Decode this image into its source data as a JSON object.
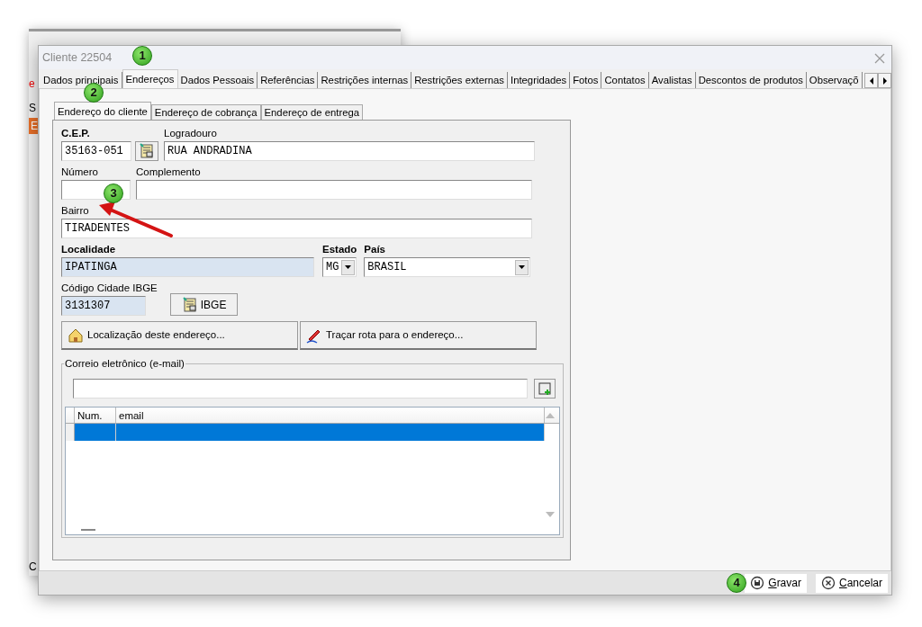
{
  "background_window": {
    "texts": [
      "e",
      "S",
      "E",
      "C"
    ]
  },
  "window": {
    "title": "Cliente 22504"
  },
  "tabs": [
    {
      "label": "Dados principais",
      "selected": false
    },
    {
      "label": "Endereços",
      "selected": true
    },
    {
      "label": "Dados Pessoais",
      "selected": false
    },
    {
      "label": "Referências",
      "selected": false
    },
    {
      "label": "Restrições internas",
      "selected": false
    },
    {
      "label": "Restrições externas",
      "selected": false
    },
    {
      "label": "Integridades",
      "selected": false
    },
    {
      "label": "Fotos",
      "selected": false
    },
    {
      "label": "Contatos",
      "selected": false
    },
    {
      "label": "Avalistas",
      "selected": false
    },
    {
      "label": "Descontos de produtos",
      "selected": false
    },
    {
      "label": "Observaçõ",
      "selected": false
    }
  ],
  "subtabs": [
    {
      "label": "Endereço do cliente",
      "selected": true
    },
    {
      "label": "Endereço de cobrança",
      "selected": false
    },
    {
      "label": "Endereço de entrega",
      "selected": false
    }
  ],
  "fields": {
    "cep": {
      "label": "C.E.P.",
      "value": "35163-051",
      "bold": true
    },
    "logradouro": {
      "label": "Logradouro",
      "value": "RUA ANDRADINA",
      "bold": false
    },
    "numero": {
      "label": "Número",
      "bold": false
    },
    "complemento": {
      "label": "Complemento",
      "bold": false
    },
    "bairro": {
      "label": "Bairro",
      "value": "TIRADENTES",
      "bold": false
    },
    "localidade": {
      "label": "Localidade",
      "value": "IPATINGA",
      "bold": true,
      "readonly": true
    },
    "estado": {
      "label": "Estado",
      "value": "MG",
      "bold": true
    },
    "pais": {
      "label": "País",
      "value": "BRASIL",
      "bold": true
    },
    "ibge": {
      "label": "Código Cidade IBGE",
      "value": "3131307",
      "bold": false,
      "readonly": true
    }
  },
  "ibge_button": "IBGE",
  "action_buttons": [
    {
      "label": "Localização deste endereço...",
      "kind": "house"
    },
    {
      "label": "Traçar rota para o endereço...",
      "kind": "pencil"
    }
  ],
  "email_group": {
    "title": "Correio eletrônico (e-mail)",
    "columns": [
      "Num.",
      "email"
    ],
    "rows": [
      {
        "selected": true
      }
    ]
  },
  "footer_buttons": [
    {
      "label": "Gravar",
      "access_key_underlined": true,
      "kind": "save"
    },
    {
      "label": "Cancelar",
      "access_key_underlined": true,
      "kind": "cancel"
    }
  ],
  "annotations": [
    {
      "label": "1"
    },
    {
      "label": "2"
    },
    {
      "label": "3"
    },
    {
      "label": "4"
    }
  ]
}
